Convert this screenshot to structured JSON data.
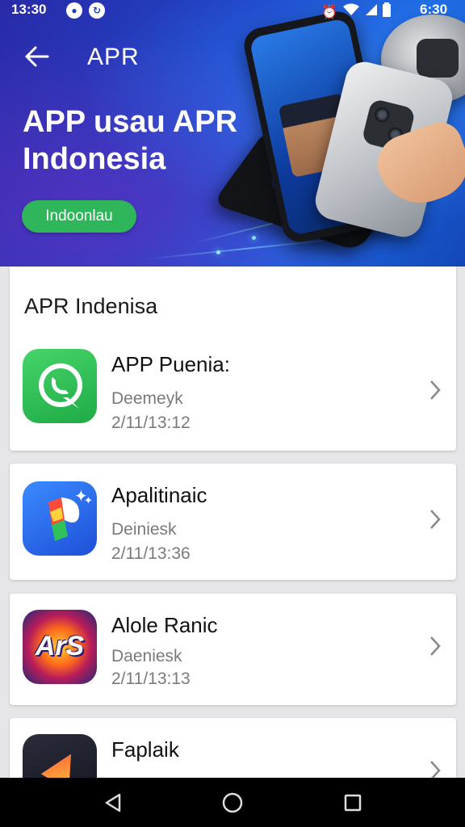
{
  "status_bar": {
    "time_left": "13:30",
    "time_right": "6:30",
    "left_icons": [
      "record-icon",
      "sync-icon"
    ],
    "right_icons": [
      "alarm-icon",
      "wifi-icon",
      "signal-icon",
      "battery-icon"
    ]
  },
  "app_bar": {
    "title": "APR",
    "back_icon": "arrow-left-icon"
  },
  "hero": {
    "title_line1": "APP usau APR",
    "title_line2": "Indonesia",
    "button_label": "Indoonlau",
    "colors": {
      "background": "#1d46c8",
      "button": "#2fb55a"
    }
  },
  "section": {
    "title": "APR Indenisa"
  },
  "apps": [
    {
      "name": "APP Puenia:",
      "subtitle": "Deemeyk",
      "date": "2/11/13:12",
      "icon": "whatsapp-icon"
    },
    {
      "name": "Apalitinaic",
      "subtitle": "Deiniesk",
      "date": "2/11/13:36",
      "icon": "colorful-p-icon"
    },
    {
      "name": "Alole Ranic",
      "subtitle": "Daeniesk",
      "date": "2/11/13:13",
      "icon": "ars-game-icon",
      "icon_text": "ArS"
    },
    {
      "name": "Faplaik",
      "subtitle": "",
      "date": "",
      "icon": "dark-app-icon"
    }
  ],
  "nav_bar": {
    "back": "triangle-back-icon",
    "home": "circle-home-icon",
    "recents": "square-recents-icon"
  }
}
